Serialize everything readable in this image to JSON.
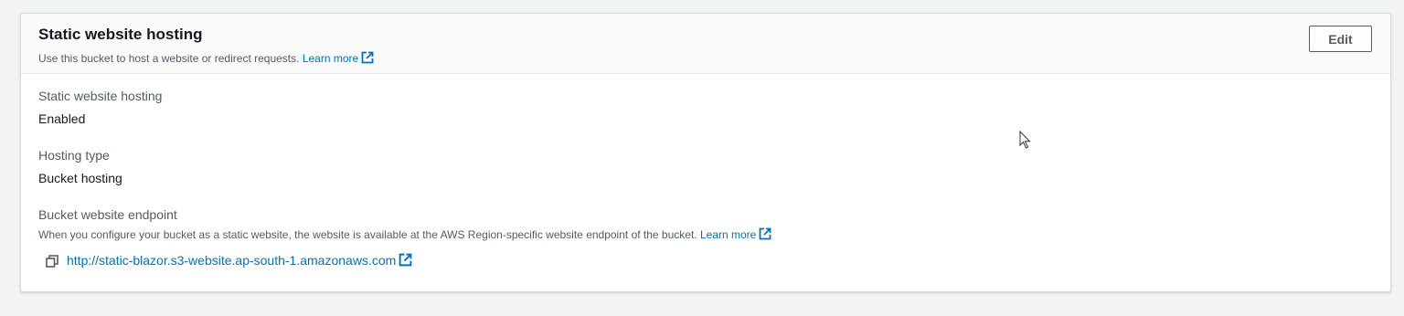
{
  "panel": {
    "title": "Static website hosting",
    "description": "Use this bucket to host a website or redirect requests.",
    "learn_more_label": "Learn more",
    "edit_label": "Edit"
  },
  "fields": {
    "hosting_label": "Static website hosting",
    "hosting_value": "Enabled",
    "type_label": "Hosting type",
    "type_value": "Bucket hosting",
    "endpoint_label": "Bucket website endpoint",
    "endpoint_description": "When you configure your bucket as a static website, the website is available at the AWS Region-specific website endpoint of the bucket.",
    "endpoint_learn_more_label": "Learn more",
    "endpoint_url": "http://static-blazor.s3-website.ap-south-1.amazonaws.com"
  },
  "icons": {
    "external_link": "external-link-icon",
    "copy": "copy-icon",
    "cursor": "mouse-cursor-icon"
  },
  "colors": {
    "link": "#0073bb",
    "background": "#f2f3f3",
    "panel_header": "#fafafa",
    "text": "#16191f",
    "secondary_text": "#545b64"
  }
}
